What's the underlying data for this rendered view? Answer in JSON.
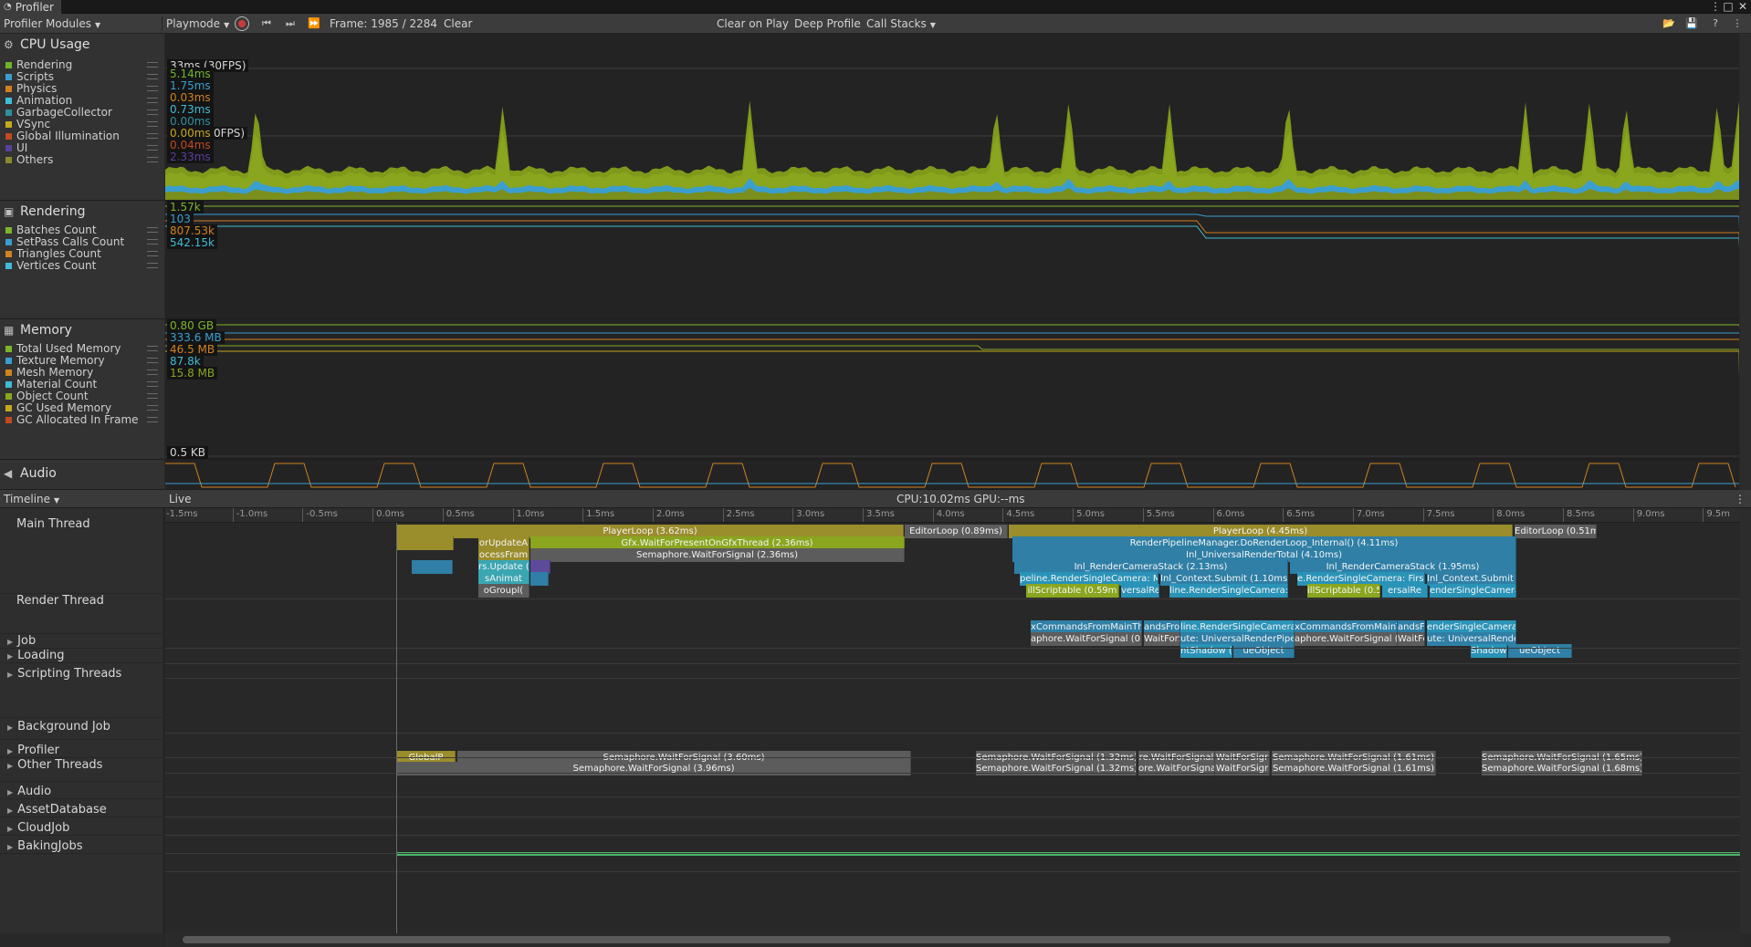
{
  "window": {
    "title": "Profiler"
  },
  "toolbar": {
    "modules_label": "Profiler Modules",
    "target_label": "Playmode",
    "frame_label": "Frame: 1985 / 2284",
    "clear_label": "Clear",
    "clear_on_play_label": "Clear on Play",
    "deep_profile_label": "Deep Profile",
    "call_stacks_label": "Call Stacks"
  },
  "cpu_module": {
    "title": "CPU Usage",
    "legend": [
      {
        "label": "Rendering",
        "color": "#6fb52a"
      },
      {
        "label": "Scripts",
        "color": "#3a9ecf"
      },
      {
        "label": "Physics",
        "color": "#d0821f"
      },
      {
        "label": "Animation",
        "color": "#3fbcd6"
      },
      {
        "label": "GarbageCollector",
        "color": "#2f8f9f"
      },
      {
        "label": "VSync",
        "color": "#c6a91c"
      },
      {
        "label": "Global Illumination",
        "color": "#c14a20"
      },
      {
        "label": "UI",
        "color": "#5b3f9c"
      },
      {
        "label": "Others",
        "color": "#8a8a30"
      }
    ],
    "target_line_label": "33ms (30FPS)",
    "target_line_label_2": "0FPS)",
    "values": [
      "5.14ms",
      "1.75ms",
      "0.03ms",
      "0.73ms",
      "0.00ms",
      "0.00ms",
      "0.04ms",
      "2.33ms"
    ]
  },
  "rendering_module": {
    "title": "Rendering",
    "legend": [
      {
        "label": "Batches Count",
        "color": "#7cb52a"
      },
      {
        "label": "SetPass Calls Count",
        "color": "#3a9ecf"
      },
      {
        "label": "Triangles Count",
        "color": "#d0821f"
      },
      {
        "label": "Vertices Count",
        "color": "#3fbcd6"
      }
    ],
    "values": [
      "1.57k",
      "103",
      "807.53k",
      "542.15k"
    ]
  },
  "memory_module": {
    "title": "Memory",
    "legend": [
      {
        "label": "Total Used Memory",
        "color": "#7cb52a"
      },
      {
        "label": "Texture Memory",
        "color": "#3a9ecf"
      },
      {
        "label": "Mesh Memory",
        "color": "#d0821f"
      },
      {
        "label": "Material Count",
        "color": "#3fbcd6"
      },
      {
        "label": "Object Count",
        "color": "#8aa61f"
      },
      {
        "label": "GC Used Memory",
        "color": "#c6a91c"
      },
      {
        "label": "GC Allocated In Frame",
        "color": "#c14a20"
      }
    ],
    "values": [
      "0.80 GB",
      "333.6 MB",
      "46.5 MB",
      "87.8k",
      "15.8 MB"
    ],
    "gc_label": "0.5 KB"
  },
  "audio_module": {
    "title": "Audio"
  },
  "timeline": {
    "view_label": "Timeline",
    "live_label": "Live",
    "stats": "CPU:10.02ms  GPU:--ms",
    "ticks": [
      "-1.5ms",
      "-1.0ms",
      "-0.5ms",
      "0.0ms",
      "0.5ms",
      "1.0ms",
      "1.5ms",
      "2.0ms",
      "2.5ms",
      "3.0ms",
      "3.5ms",
      "4.0ms",
      "4.5ms",
      "5.0ms",
      "5.5ms",
      "6.0ms",
      "6.5ms",
      "7.0ms",
      "7.5ms",
      "8.0ms",
      "8.5ms",
      "9.0ms",
      "9.5m"
    ],
    "threads": [
      "Main Thread",
      "Render Thread",
      "Job",
      "Loading",
      "Scripting Threads",
      "Background Job",
      "Profiler",
      "Other Threads",
      "Audio",
      "AssetDatabase",
      "CloudJob",
      "BakingJobs"
    ],
    "bars": {
      "playerloop1": "PlayerLoop (3.62ms)",
      "editorloop": "EditorLoop (0.89ms)",
      "playerloop2": "PlayerLoop (4.45ms)",
      "editorloop2": "EditorLoop (0.51m",
      "waitgfx": "Gfx.WaitForPresentOnGfxThread (2.36ms)",
      "semaphore1": "Semaphore.WaitForSignal (2.36ms)",
      "renderloop": "RenderPipelineManager.DoRenderLoop_Internal() (4.11ms)",
      "urptotal": "Inl_UniversalRenderTotal (4.10ms)",
      "stack1": "Inl_RenderCameraStack (2.13ms)",
      "stack2": "Inl_RenderCameraStack (1.95ms)",
      "submit1": "Inl_Context.Submit (1.10ms)",
      "submit2": "Inl_Context.Submit (0.93ms)",
      "rsc1": "peline.RenderSingleCamera: M",
      "rsc2": "e.RenderSingleCamera: First",
      "scriptable1": "illScriptable (0.59m",
      "scriptable2": "illScriptable (0.59m",
      "versal1": "versalRen",
      "versal2": "ersalRe",
      "rsc3": "line.RenderSingleCamera: Ma",
      "rsc4": "enderSingleCamera: First",
      "updateA": "orUpdateA",
      "processFrame": "ocessFram",
      "rsupdate": "rs.Update (",
      "animat": "sAnimat",
      "groupI": "oGroupI(",
      "rt_cmd1": "xCommandsFromMainThr",
      "rt_cmd2": "andsFromMa",
      "rt_rsc1": "line.RenderSingleCamera: Ma",
      "rt_cmd3": "xCommandsFromMainThr",
      "rt_cmd4": "andsFrom",
      "rt_rsc2": "enderSingleCamera: First",
      "rt_wait1": "aphore.WaitForSignal (0.8",
      "rt_wait2": "WaitForSig",
      "rt_urp1": "ute: UniversalRenderPipelineA",
      "rt_wait3": "aphore.WaitForSignal (0.8",
      "rt_wait4": "WaitForSig",
      "rt_urp2": "ute: UniversalRenderPipeline",
      "rt_shadow1": "ntShadow (",
      "rt_obj1": "ueObject",
      "rt_shadow2": "Shadow",
      "rt_obj2": "ueObject",
      "prof1": "Semaphore.WaitForSignal (3.60ms)",
      "prof2": "Semaphore.WaitForSignal (1.32ms)",
      "prof3": "Semaphore.WaitForSignal (1.61ms)",
      "prof4": "Semaphore.WaitForSignal (1.65ms)",
      "prof5": "Semaphore.WaitForSignal (3.96ms)",
      "prof6": "Semaphore.WaitForSignal (1.32ms)",
      "prof7": "Semaphore.WaitForSignal (1.61ms)",
      "prof8": "Semaphore.WaitForSignal (1.68ms)",
      "prof9": "re.WaitForSignal",
      "prof10": "WaitForSigr",
      "prof11": "ore.WaitForSignal (0",
      "prof12": "WaitForSigr",
      "globalp": "GlobalP"
    }
  }
}
